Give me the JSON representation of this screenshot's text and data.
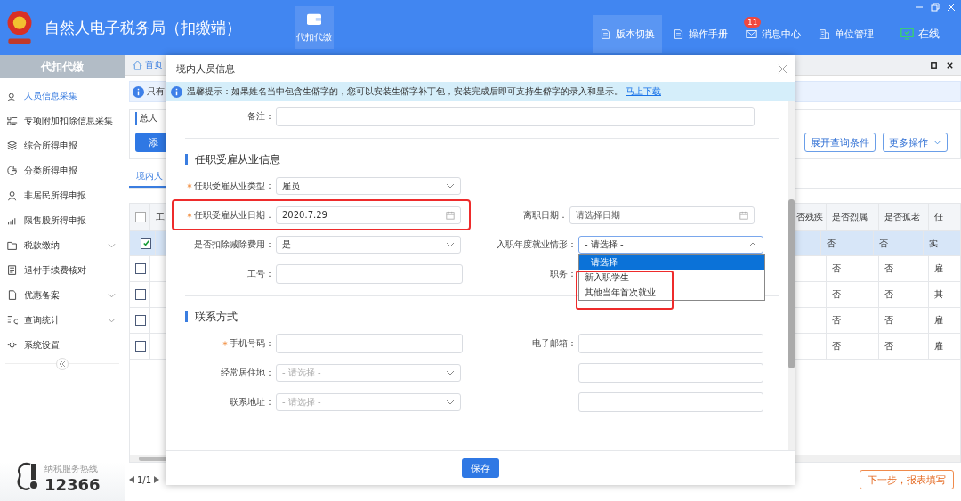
{
  "app": {
    "title": "自然人电子税务局（扣缴端）",
    "module": "代扣代缴"
  },
  "toolbar": [
    {
      "label": "版本切换",
      "selected": true
    },
    {
      "label": "操作手册",
      "selected": false
    },
    {
      "label": "消息中心",
      "selected": false,
      "badge": "11"
    },
    {
      "label": "单位管理",
      "selected": false
    }
  ],
  "status": {
    "label": "在线",
    "online": true
  },
  "sidebar": {
    "title": "代扣代缴",
    "items": [
      {
        "label": "人员信息采集",
        "selected": true
      },
      {
        "label": "专项附加扣除信息采集",
        "selected": false
      },
      {
        "label": "综合所得申报",
        "selected": false
      },
      {
        "label": "分类所得申报",
        "selected": false
      },
      {
        "label": "非居民所得申报",
        "selected": false
      },
      {
        "label": "限售股所得申报",
        "selected": false
      },
      {
        "label": "税款缴纳",
        "selected": false,
        "expandable": true
      },
      {
        "label": "退付手续费核对",
        "selected": false
      },
      {
        "label": "优惠备案",
        "selected": false,
        "expandable": true
      },
      {
        "label": "查询统计",
        "selected": false,
        "expandable": true
      },
      {
        "label": "系统设置",
        "selected": false
      }
    ],
    "hotline_label": "纳税服务热线",
    "hotline": "12366"
  },
  "page": {
    "breadcrumb": "首页",
    "info": "只有",
    "summary": "总人",
    "add_button": "添",
    "buttons": [
      "展开查询条件",
      "更多操作"
    ],
    "tab": "境内人",
    "table": {
      "header_checked": false,
      "columns": [
        "工",
        "否残疾",
        "是否烈属",
        "是否孤老",
        "任"
      ],
      "rows": [
        {
          "checked": true,
          "selected": true,
          "cells": [
            "",
            "",
            "否",
            "否",
            "实"
          ]
        },
        {
          "checked": false,
          "selected": false,
          "cells": [
            "",
            "",
            "否",
            "否",
            "雇"
          ]
        },
        {
          "checked": false,
          "selected": false,
          "cells": [
            "",
            "",
            "否",
            "否",
            "其"
          ]
        },
        {
          "checked": false,
          "selected": false,
          "cells": [
            "",
            "",
            "否",
            "否",
            "雇"
          ]
        },
        {
          "checked": false,
          "selected": false,
          "cells": [
            "",
            "",
            "否",
            "否",
            "雇"
          ]
        }
      ]
    },
    "pager": "1/1",
    "next_button": "下一步，报表填写"
  },
  "dialog": {
    "title": "境内人员信息",
    "notice_label": "温馨提示：",
    "notice": "如果姓名当中包含生僻字的，您可以安装生僻字补丁包，安装完成后即可支持生僻字的录入和显示。",
    "notice_link": "马上下载",
    "remark_label": "备注：",
    "sections": [
      {
        "title": "任职受雇从业信息",
        "rows": [
          [
            {
              "label": "任职受雇从业类型：",
              "required": true,
              "kind": "select",
              "value": "雇员"
            }
          ],
          [
            {
              "label": "任职受雇从业日期：",
              "required": true,
              "kind": "date",
              "value": "2020.7.29",
              "highlighted": true
            },
            {
              "label": "离职日期：",
              "kind": "date",
              "placeholder": "请选择日期"
            }
          ],
          [
            {
              "label": "是否扣除减除费用：",
              "kind": "select",
              "value": "是"
            },
            {
              "label": "入职年度就业情形：",
              "kind": "select",
              "value": "- 请选择 -",
              "expanded": true,
              "options": [
                {
                  "label": "- 请选择 -",
                  "selected": true
                },
                {
                  "label": "新入职学生",
                  "selected": false
                },
                {
                  "label": "其他当年首次就业",
                  "selected": false
                }
              ],
              "options_highlighted": true
            }
          ],
          [
            {
              "label": "工号：",
              "kind": "text"
            },
            {
              "label": "职务：",
              "kind": "covered"
            }
          ]
        ]
      },
      {
        "title": "联系方式",
        "rows": [
          [
            {
              "label": "手机号码：",
              "required": true,
              "kind": "text"
            },
            {
              "label": "电子邮箱：",
              "kind": "text"
            }
          ],
          [
            {
              "label": "经常居住地：",
              "kind": "select",
              "placeholder": "- 请选择 -"
            },
            {
              "kind": "text"
            }
          ],
          [
            {
              "label": "联系地址：",
              "kind": "select",
              "placeholder": "- 请选择 -"
            },
            {
              "kind": "text"
            }
          ]
        ]
      }
    ],
    "save_button": "保存"
  }
}
